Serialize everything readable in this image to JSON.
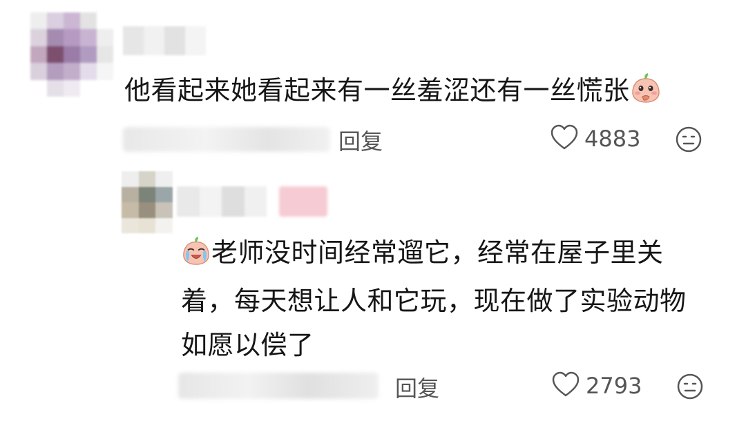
{
  "comments": [
    {
      "text": "他看起来她看起来有一丝羞涩还有一丝慌张",
      "emoji": "peach-shy-emoji",
      "reply_label": "回复",
      "likes": "4883"
    },
    {
      "emoji": "peach-crying-emoji",
      "lines": [
        "老师没时间经常遛它，经常在屋子里关",
        "着，每天想让人和它玩，现在做了实验动物",
        "如愿以偿了"
      ],
      "reply_label": "回复",
      "likes": "2793"
    }
  ],
  "icons": {
    "like": "heart-outline-icon",
    "dislike": "meh-face-icon"
  },
  "colors": {
    "text": "#161616",
    "secondary": "#555555",
    "peach": "#f4b9a6",
    "leaf": "#6fbf5a"
  }
}
